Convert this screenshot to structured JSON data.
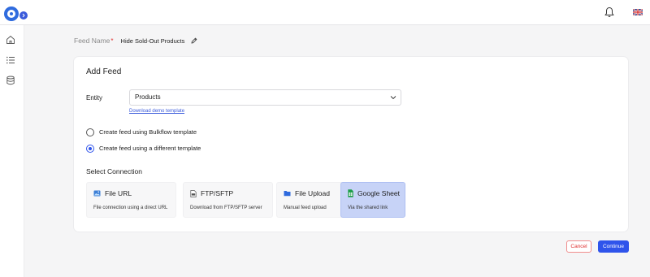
{
  "header": {
    "logo_icon": "app-logo-icon",
    "collapse_icon": "chevron-right-icon",
    "notification_icon": "bell-icon",
    "language_icon": "uk-flag-icon"
  },
  "sidebar": {
    "items": [
      {
        "icon": "home-icon"
      },
      {
        "icon": "list-icon"
      },
      {
        "icon": "database-icon"
      }
    ]
  },
  "feed_name": {
    "label": "Feed Name",
    "required_marker": "*",
    "value": "Hide Sold-Out Products"
  },
  "card": {
    "title": "Add Feed",
    "entity": {
      "label": "Entity",
      "selected": "Products",
      "demo_link": "Download demo template"
    },
    "radio_options": [
      {
        "label": "Create feed using Bulkflow template",
        "checked": false
      },
      {
        "label": "Create feed using a different template",
        "checked": true
      }
    ],
    "select_connection_label": "Select Connection",
    "connections": [
      {
        "title": "File URL",
        "description": "File connection using a direct URL",
        "icon": "image-file-icon",
        "selected": false
      },
      {
        "title": "FTP/SFTP",
        "description": "Download from FTP/SFTP server",
        "icon": "ftp-file-icon",
        "selected": false
      },
      {
        "title": "File Upload",
        "description": "Manual feed upload",
        "icon": "folder-icon",
        "selected": false
      },
      {
        "title": "Google Sheet",
        "description": "Via the shared link",
        "icon": "google-sheet-icon",
        "selected": true
      }
    ]
  },
  "actions": {
    "cancel": "Cancel",
    "continue": "Continue"
  },
  "colors": {
    "primary": "#2f54eb",
    "danger": "#e03131",
    "selected_card": "#c7d3f7"
  }
}
